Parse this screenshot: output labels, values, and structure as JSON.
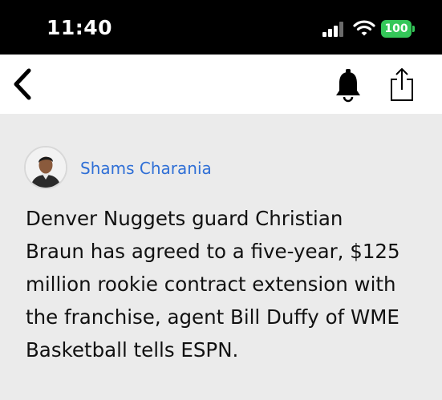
{
  "status_bar": {
    "time": "11:40",
    "battery": "100"
  },
  "nav": {
    "back_icon": "chevron-left-icon",
    "bell_icon": "bell-icon",
    "share_icon": "share-icon"
  },
  "post": {
    "author": "Shams Charania",
    "lines": [
      "Denver Nuggets guard Christian",
      "Braun has agreed to a five-year, $125",
      "million rookie contract extension with",
      "the franchise, agent Bill Duffy of WME",
      "Basketball tells ESPN."
    ]
  },
  "colors": {
    "author_link": "#2f6fd6",
    "battery": "#34c759",
    "status_bar_bg": "#000000",
    "content_bg": "#ebebeb"
  }
}
